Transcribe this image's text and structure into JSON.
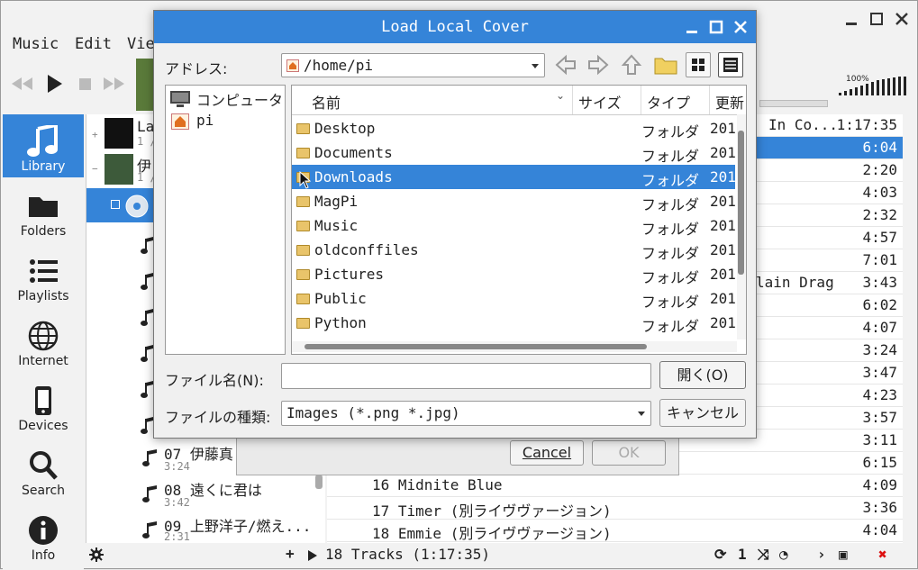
{
  "main_window": {
    "menu": [
      "Music",
      "Edit",
      "Vie"
    ],
    "volume_label": "100%",
    "sidebar": [
      {
        "label": "Library",
        "icon": "music-note-icon"
      },
      {
        "label": "Folders",
        "icon": "folder-icon"
      },
      {
        "label": "Playlists",
        "icon": "list-icon"
      },
      {
        "label": "Internet",
        "icon": "globe-icon"
      },
      {
        "label": "Devices",
        "icon": "phone-icon"
      },
      {
        "label": "Search",
        "icon": "search-icon"
      },
      {
        "label": "Info",
        "icon": "info-icon"
      }
    ],
    "tree": {
      "artist1": {
        "name": "La",
        "sub": "1 /"
      },
      "artist2": {
        "name": "伊",
        "sub": "1 /"
      },
      "tracks": [
        {
          "title": "07 伊藤真",
          "dur": "3:24"
        },
        {
          "title": "08 遠くに君は",
          "dur": "3:42"
        },
        {
          "title": "09 上野洋子/燃え...",
          "dur": "2:31"
        }
      ]
    },
    "playlist": {
      "header_fragment": "In Co...",
      "header_duration": "1:17:35",
      "rows": [
        {
          "title": "",
          "duration": "6:04"
        },
        {
          "title": "",
          "duration": "2:20"
        },
        {
          "title": "",
          "duration": "4:03"
        },
        {
          "title": "",
          "duration": "2:32"
        },
        {
          "title": "",
          "duration": "4:57"
        },
        {
          "title": "",
          "duration": "7:01"
        },
        {
          "title": "lain Drag",
          "duration": "3:43"
        },
        {
          "title": "",
          "duration": "6:02"
        },
        {
          "title": "",
          "duration": "4:07"
        },
        {
          "title": "",
          "duration": "3:24"
        },
        {
          "title": "",
          "duration": "3:47"
        },
        {
          "title": "",
          "duration": "4:23"
        },
        {
          "title": "",
          "duration": "3:57"
        },
        {
          "title": "",
          "duration": "3:11"
        },
        {
          "title": "",
          "duration": "6:15"
        },
        {
          "title": "16 Midnite Blue",
          "duration": "4:09"
        },
        {
          "title": "17 Timer (別ライヴヴァージョン)",
          "duration": "3:36"
        },
        {
          "title": "18 Emmie (別ライヴヴァージョン)",
          "duration": "4:04"
        }
      ]
    },
    "status": {
      "tracks": "18 Tracks (1:17:35)",
      "repeat_count": "1"
    },
    "ghost_dialog": {
      "cancel": "Cancel",
      "ok": "OK"
    }
  },
  "file_dialog": {
    "title": "Load Local Cover",
    "address_label": "アドレス:",
    "address_value": "/home/pi",
    "places": [
      "コンピュータ",
      "pi"
    ],
    "columns": [
      "名前",
      "サイズ",
      "タイプ",
      "更新"
    ],
    "files": [
      {
        "name": "Desktop",
        "type": "フォルダ",
        "date": "201"
      },
      {
        "name": "Documents",
        "type": "フォルダ",
        "date": "201"
      },
      {
        "name": "Downloads",
        "type": "フォルダ",
        "date": "201"
      },
      {
        "name": "MagPi",
        "type": "フォルダ",
        "date": "201"
      },
      {
        "name": "Music",
        "type": "フォルダ",
        "date": "201"
      },
      {
        "name": "oldconffiles",
        "type": "フォルダ",
        "date": "201"
      },
      {
        "name": "Pictures",
        "type": "フォルダ",
        "date": "201"
      },
      {
        "name": "Public",
        "type": "フォルダ",
        "date": "201"
      },
      {
        "name": "Python",
        "type": "フォルダ",
        "date": "201"
      }
    ],
    "selected_file": "Downloads",
    "filename_label": "ファイル名(N):",
    "filename_value": "",
    "filetype_label": "ファイルの種類:",
    "filetype_value": "Images (*.png *.jpg)",
    "open_button": "開く(O)",
    "cancel_button": "キャンセル"
  },
  "colors": {
    "accent": "#3584d8",
    "folder": "#e9c46a"
  }
}
